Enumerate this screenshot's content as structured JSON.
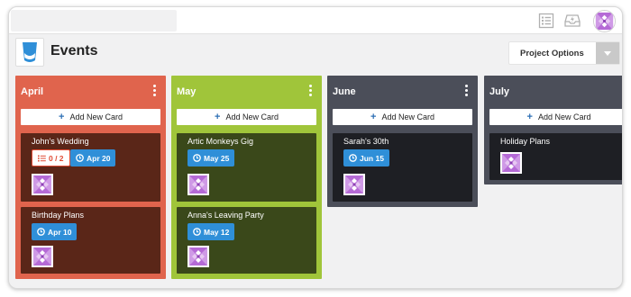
{
  "colors": {
    "april": "#e0644d",
    "april_card": "#5a2618",
    "may": "#a0c53a",
    "may_card": "#3a481a",
    "june": "#4b4e59",
    "june_card": "#1e1f24",
    "july": "#4b4e59",
    "july_card": "#1e1f24",
    "date_badge": "#2f8fd8"
  },
  "topbar": {
    "search_placeholder": "",
    "icons": [
      "list-icon",
      "inbox-icon"
    ]
  },
  "header": {
    "title": "Events",
    "project_options": "Project Options"
  },
  "add_card_label": "Add New Card",
  "columns": [
    {
      "title": "April",
      "cards": [
        {
          "title": "John's Wedding",
          "checklist": "0 / 2",
          "date": "Apr 20"
        },
        {
          "title": "Birthday Plans",
          "date": "Apr 10"
        }
      ]
    },
    {
      "title": "May",
      "cards": [
        {
          "title": "Artic Monkeys Gig",
          "date": "May 25"
        },
        {
          "title": "Anna's Leaving Party",
          "date": "May 12"
        }
      ]
    },
    {
      "title": "June",
      "cards": [
        {
          "title": "Sarah's 30th",
          "date": "Jun 15"
        }
      ]
    },
    {
      "title": "July",
      "cards": [
        {
          "title": "Holiday Plans"
        }
      ]
    }
  ]
}
